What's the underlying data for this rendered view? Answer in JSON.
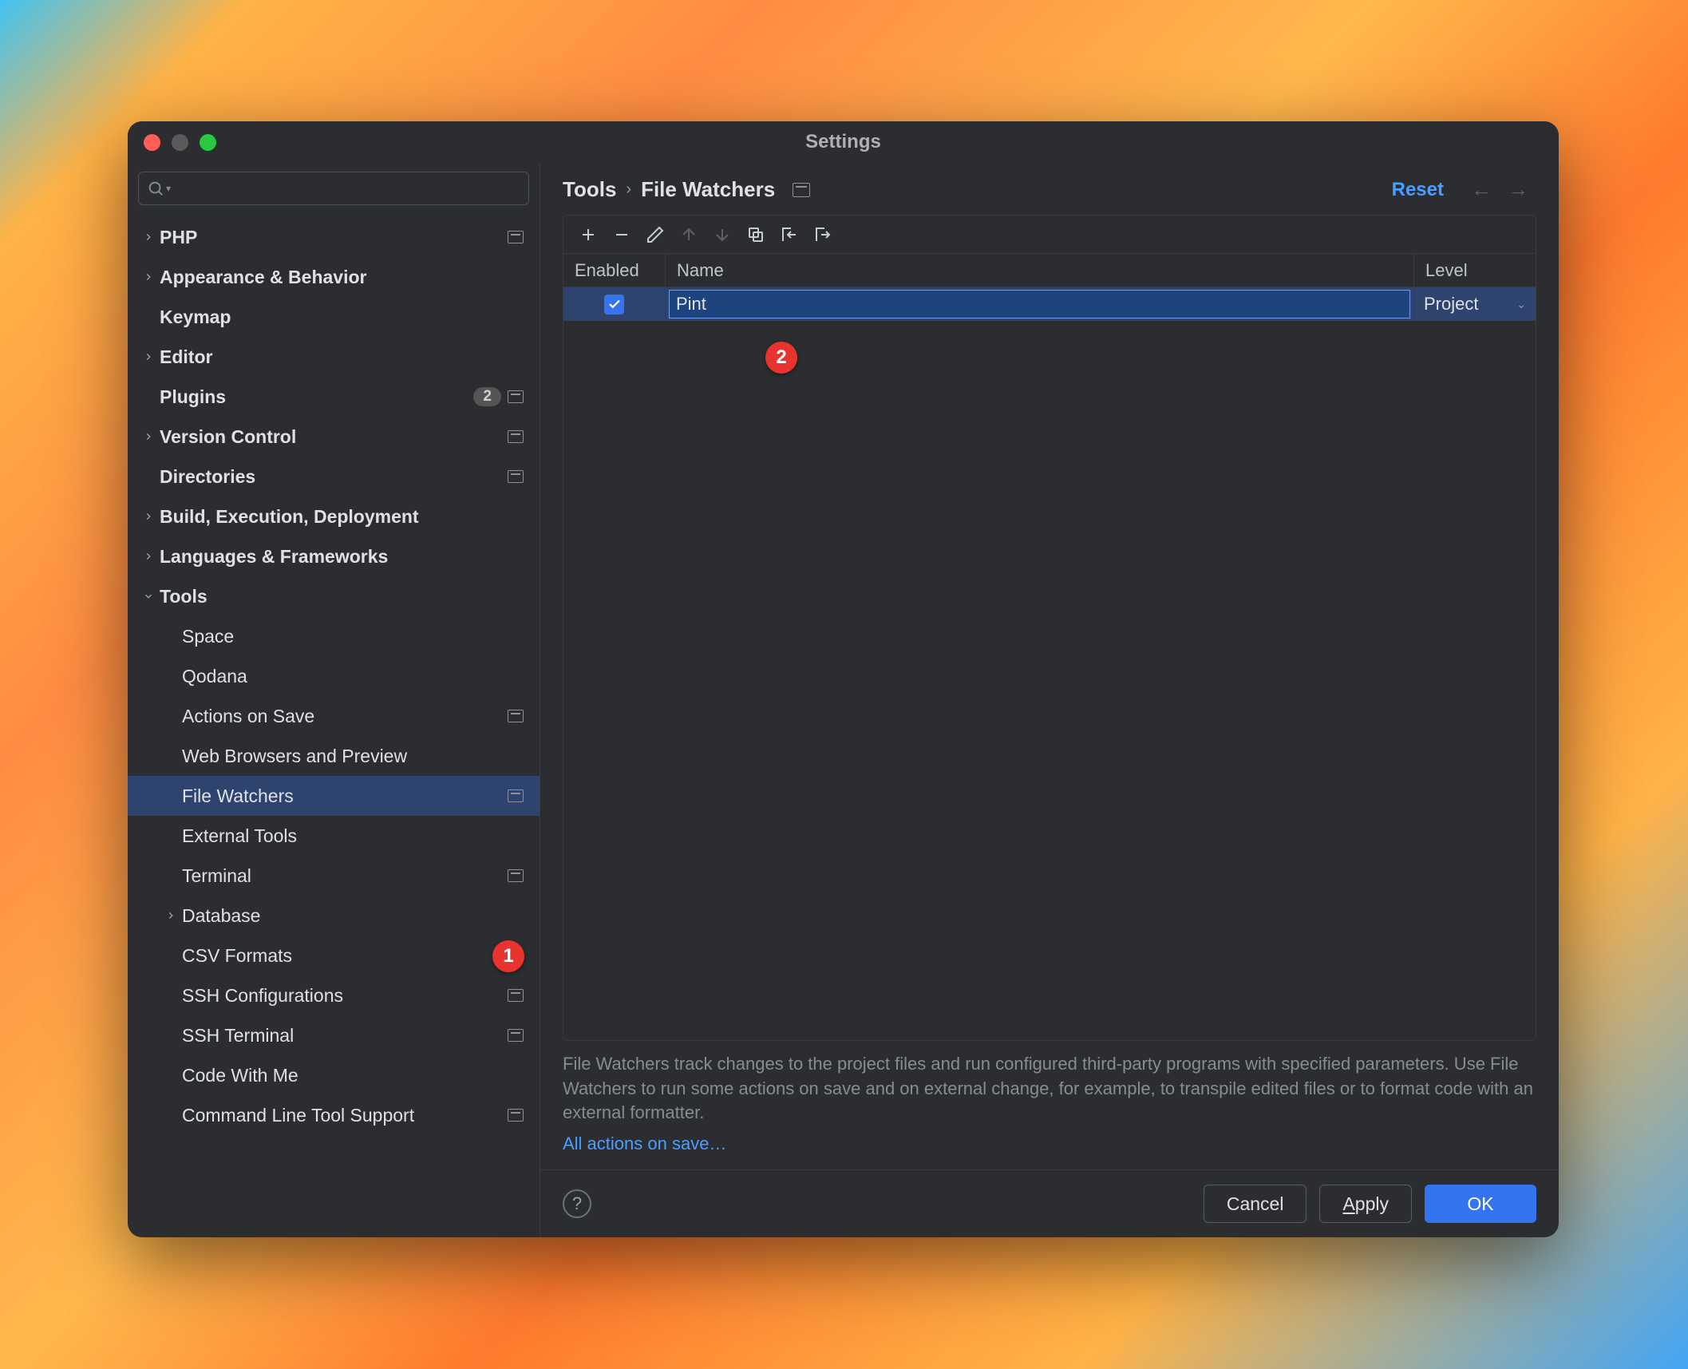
{
  "title": "Settings",
  "search_placeholder": "",
  "sidebar": {
    "items": [
      {
        "label": "PHP",
        "bold": true,
        "chev": "right",
        "proj": true,
        "indent": 0
      },
      {
        "label": "Appearance & Behavior",
        "bold": true,
        "chev": "right",
        "indent": 0
      },
      {
        "label": "Keymap",
        "bold": true,
        "indent": 0
      },
      {
        "label": "Editor",
        "bold": true,
        "chev": "right",
        "indent": 0
      },
      {
        "label": "Plugins",
        "bold": true,
        "badge": "2",
        "proj": true,
        "indent": 0
      },
      {
        "label": "Version Control",
        "bold": true,
        "chev": "right",
        "proj": true,
        "indent": 0
      },
      {
        "label": "Directories",
        "bold": true,
        "proj": true,
        "indent": 0
      },
      {
        "label": "Build, Execution, Deployment",
        "bold": true,
        "chev": "right",
        "indent": 0
      },
      {
        "label": "Languages & Frameworks",
        "bold": true,
        "chev": "right",
        "indent": 0
      },
      {
        "label": "Tools",
        "bold": true,
        "chev": "down",
        "indent": 0
      },
      {
        "label": "Space",
        "indent": 1
      },
      {
        "label": "Qodana",
        "indent": 1
      },
      {
        "label": "Actions on Save",
        "proj": true,
        "indent": 1
      },
      {
        "label": "Web Browsers and Preview",
        "indent": 1
      },
      {
        "label": "File Watchers",
        "proj": true,
        "indent": 1,
        "selected": true
      },
      {
        "label": "External Tools",
        "indent": 1
      },
      {
        "label": "Terminal",
        "proj": true,
        "indent": 1
      },
      {
        "label": "Database",
        "chev": "right",
        "indent": 1
      },
      {
        "label": "CSV Formats",
        "indent": 1
      },
      {
        "label": "SSH Configurations",
        "proj": true,
        "indent": 1
      },
      {
        "label": "SSH Terminal",
        "proj": true,
        "indent": 1
      },
      {
        "label": "Code With Me",
        "indent": 1
      },
      {
        "label": "Command Line Tool Support",
        "proj": true,
        "indent": 1
      }
    ]
  },
  "breadcrumb": {
    "parts": [
      "Tools",
      "File Watchers"
    ]
  },
  "reset_label": "Reset",
  "table": {
    "columns": {
      "enabled": "Enabled",
      "name": "Name",
      "level": "Level"
    },
    "rows": [
      {
        "enabled": true,
        "name": "Pint",
        "level": "Project"
      }
    ]
  },
  "description": "File Watchers track changes to the project files and run configured third-party programs with specified parameters. Use File Watchers to run some actions on save and on external change, for example, to transpile edited files or to format code with an external formatter.",
  "link_text": "All actions on save…",
  "buttons": {
    "cancel": "Cancel",
    "apply": "Apply",
    "ok": "OK"
  },
  "annotations": {
    "a1": "1",
    "a2": "2"
  }
}
